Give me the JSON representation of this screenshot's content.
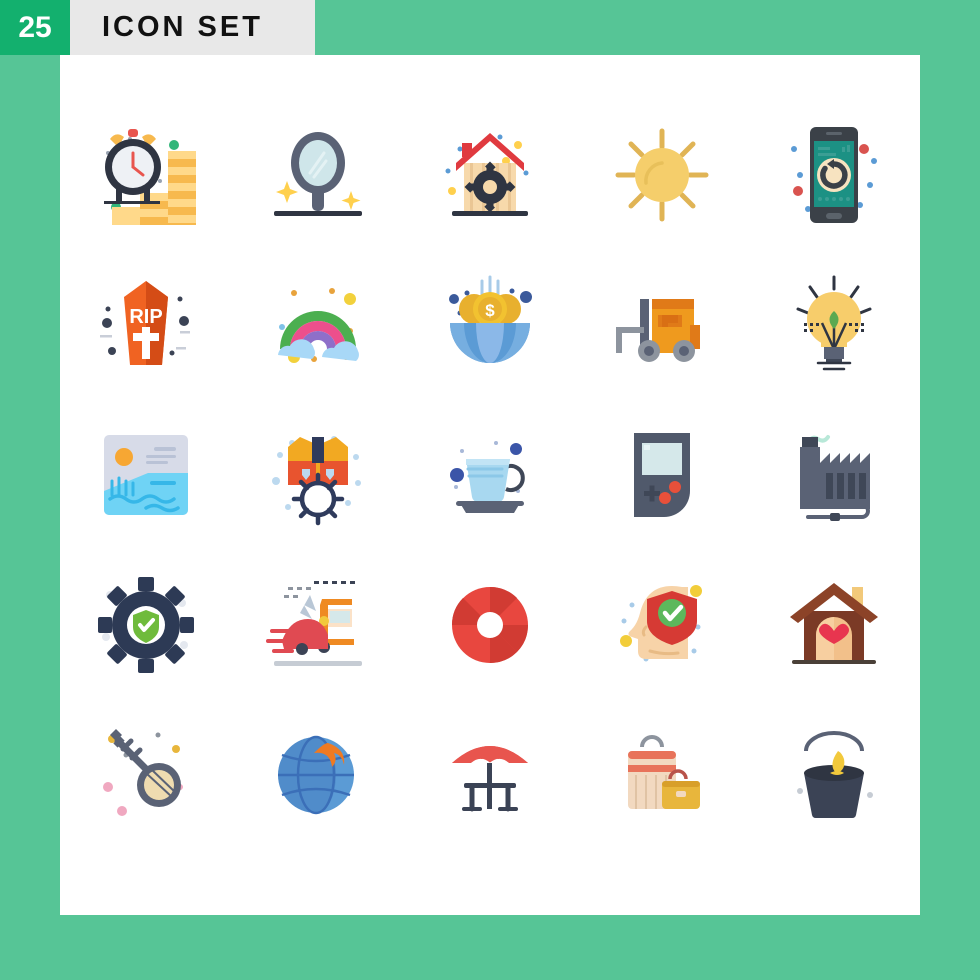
{
  "header": {
    "count": "25",
    "title": "ICON SET",
    "badge_color": "#13b06e",
    "title_bg": "#e8e8e8",
    "page_bg": "#56c596",
    "canvas_bg": "#ffffff"
  },
  "icons": [
    {
      "id": 1,
      "name": "alarm-clock-coins-growth-icon",
      "label": "Time Is Money",
      "colors": [
        "#ffc95c",
        "#f7a440",
        "#3b4355",
        "#e8554e",
        "#32b67a"
      ]
    },
    {
      "id": 2,
      "name": "hand-mirror-icon",
      "label": "Mirror",
      "colors": [
        "#5a6275",
        "#cfe6ea",
        "#ffd04d"
      ]
    },
    {
      "id": 3,
      "name": "smart-home-gear-icon",
      "label": "Home Settings",
      "colors": [
        "#f7d9ab",
        "#e03a3f",
        "#2f3542",
        "#ffd04d"
      ]
    },
    {
      "id": 4,
      "name": "sun-brightness-icon",
      "label": "Sun",
      "colors": [
        "#f5ce6b",
        "#e0b455"
      ]
    },
    {
      "id": 5,
      "name": "mobile-restore-icon",
      "label": "Phone Restore",
      "colors": [
        "#3b4148",
        "#1c9184",
        "#f7e3c0",
        "#d9534f"
      ]
    },
    {
      "id": 6,
      "name": "coffin-rip-icon",
      "label": "RIP Coffin",
      "colors": [
        "#f06322",
        "#d44c16",
        "#ffffff",
        "#3b4355"
      ]
    },
    {
      "id": 7,
      "name": "rainbow-clouds-icon",
      "label": "Rainbow",
      "colors": [
        "#4caf50",
        "#ec4f8c",
        "#8e6fc9",
        "#a8d8f7",
        "#f2d13c"
      ]
    },
    {
      "id": 8,
      "name": "global-finance-coins-icon",
      "label": "Global Economy",
      "colors": [
        "#5b9bd5",
        "#8bb8e8",
        "#f2c230",
        "#3b5a9b"
      ]
    },
    {
      "id": 9,
      "name": "forklift-icon",
      "label": "Forklift",
      "colors": [
        "#ef9a1e",
        "#e07a18",
        "#8d949e",
        "#5a6275"
      ]
    },
    {
      "id": 10,
      "name": "eco-light-bulb-icon",
      "label": "Eco Idea",
      "colors": [
        "#f7cd6b",
        "#5ba951",
        "#5a6275",
        "#2f3542"
      ]
    },
    {
      "id": 11,
      "name": "landscape-photo-icon",
      "label": "Seascape Photo",
      "colors": [
        "#d7dbe8",
        "#6fd3f5",
        "#f7a733",
        "#36b7e8"
      ]
    },
    {
      "id": 12,
      "name": "safety-vest-gear-icon",
      "label": "Work Safety",
      "colors": [
        "#f2a922",
        "#e8542f",
        "#2f3b5c",
        "#bcd9ef"
      ]
    },
    {
      "id": 13,
      "name": "tea-cup-icon",
      "label": "Tea Cup",
      "colors": [
        "#a8d8f0",
        "#8cc8e8",
        "#5a6275",
        "#3b55a8"
      ]
    },
    {
      "id": 14,
      "name": "handheld-console-icon",
      "label": "Game Console",
      "colors": [
        "#50596b",
        "#d5e8ea",
        "#e8503a"
      ]
    },
    {
      "id": 15,
      "name": "factory-power-icon",
      "label": "Factory Power",
      "colors": [
        "#5a6275",
        "#3f4757",
        "#b8e8d8"
      ]
    },
    {
      "id": 16,
      "name": "security-gear-shield-icon",
      "label": "Security Settings",
      "colors": [
        "#2d3a55",
        "#ffffff",
        "#6fbb3c"
      ]
    },
    {
      "id": 17,
      "name": "car-crash-truck-icon",
      "label": "Vehicle Collision",
      "colors": [
        "#e04a52",
        "#ef8a22",
        "#b9c7d6",
        "#d3d7dc"
      ]
    },
    {
      "id": 18,
      "name": "lifebuoy-icon",
      "label": "Lifebuoy",
      "colors": [
        "#e8473f",
        "#d13b33",
        "#ffffff"
      ]
    },
    {
      "id": 19,
      "name": "mental-protection-icon",
      "label": "Mind Protection",
      "colors": [
        "#f7d3a8",
        "#d63a34",
        "#5cb85c",
        "#f2cd3a"
      ]
    },
    {
      "id": 20,
      "name": "pet-house-heart-icon",
      "label": "Pet House",
      "colors": [
        "#7b3a26",
        "#a8543a",
        "#f2c97a",
        "#e8354f"
      ]
    },
    {
      "id": 21,
      "name": "banjo-key-icon",
      "label": "Banjo",
      "colors": [
        "#5a6275",
        "#e8b63c",
        "#f0a8c0",
        "#efdcb0"
      ]
    },
    {
      "id": 22,
      "name": "global-network-icon",
      "label": "Global Network",
      "colors": [
        "#3b6fb8",
        "#5b9bd5",
        "#ef7a22"
      ]
    },
    {
      "id": 23,
      "name": "patio-umbrella-table-icon",
      "label": "Patio Table",
      "colors": [
        "#e8554e",
        "#3b4355",
        "#ffffff"
      ]
    },
    {
      "id": 24,
      "name": "luggage-suitcases-icon",
      "label": "Luggage",
      "colors": [
        "#f2d9c0",
        "#e8735a",
        "#e8b63c",
        "#b8534a"
      ]
    },
    {
      "id": 25,
      "name": "paint-bucket-icon",
      "label": "Paint Bucket",
      "colors": [
        "#3b4355",
        "#2f3542",
        "#f2c93c"
      ]
    }
  ]
}
